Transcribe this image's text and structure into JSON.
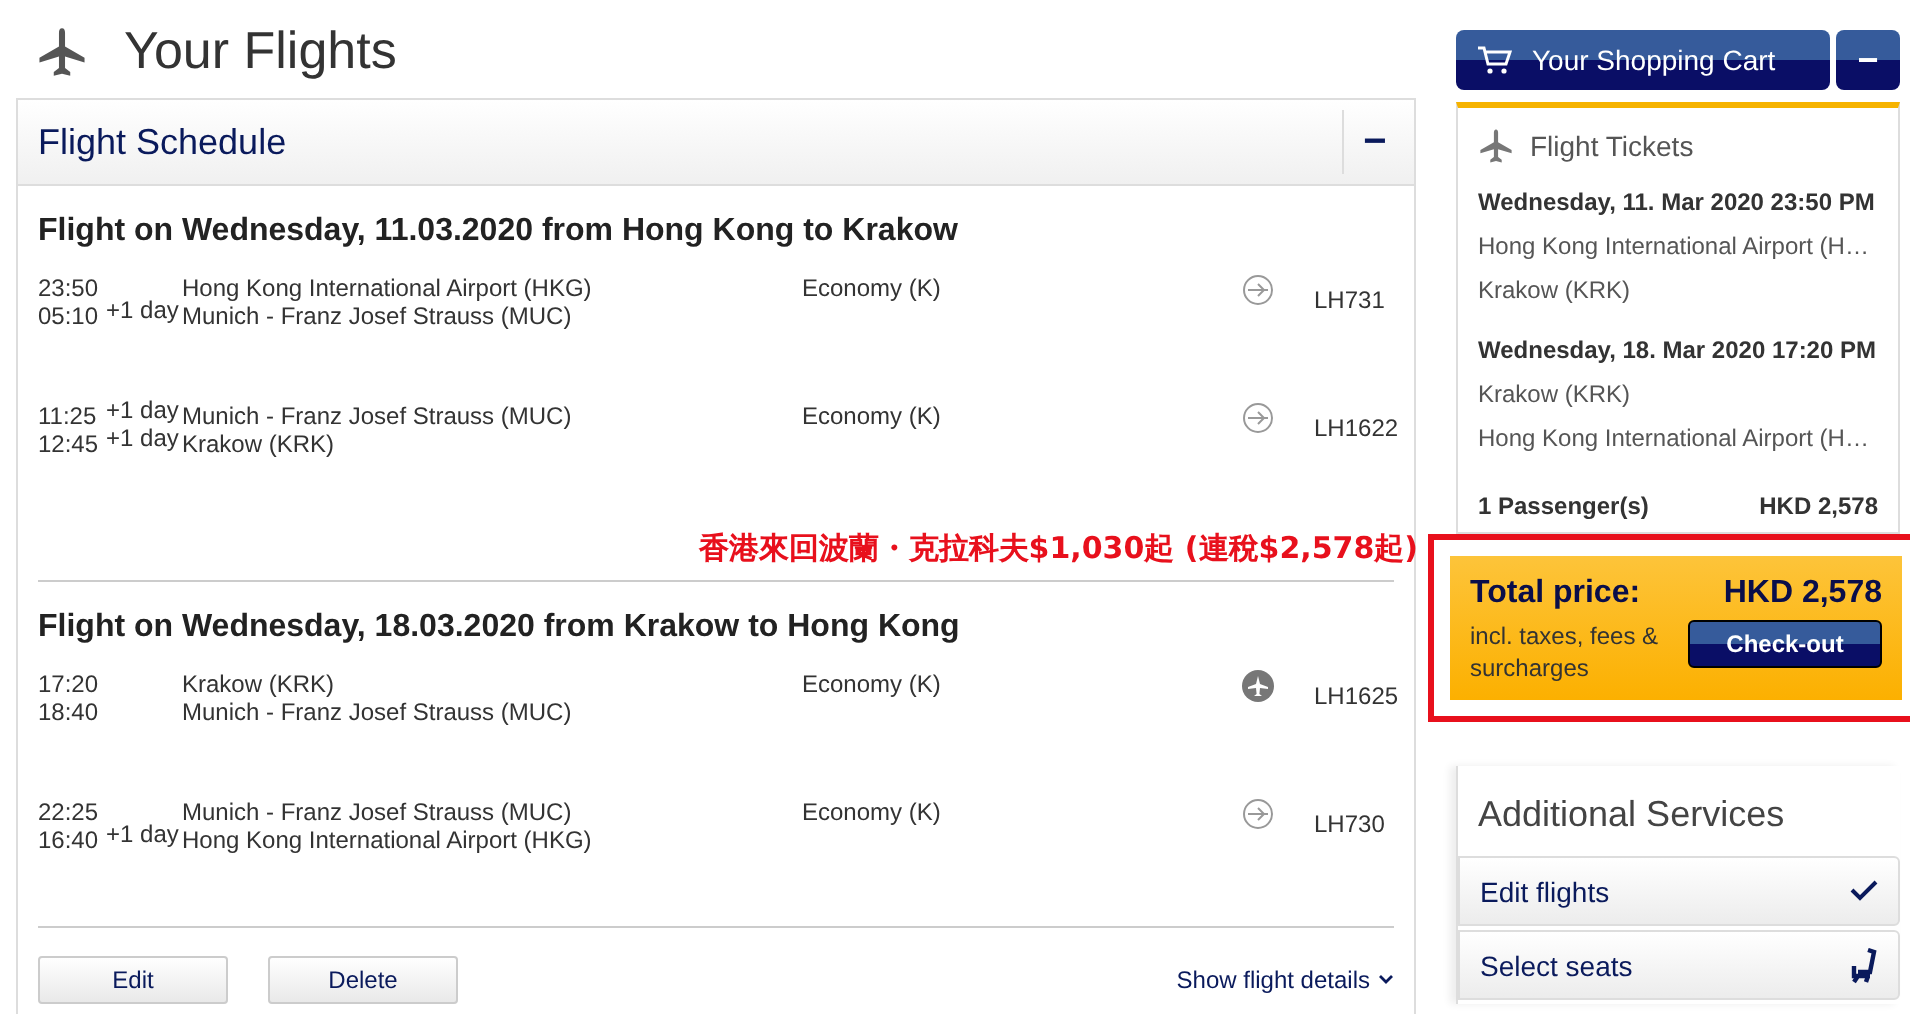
{
  "page_title": "Your Flights",
  "schedule": {
    "title": "Flight Schedule",
    "collapse": "−",
    "flights": [
      {
        "heading": "Flight on Wednesday, 11.03.2020 from Hong Kong to Krakow",
        "segments": [
          {
            "dep_time": "23:50",
            "from": "Hong Kong International Airport (HKG)",
            "arr_time": "05:10",
            "arr_plus": "+1 day",
            "to": "Munich - Franz Josef Strauss (MUC)",
            "cabin": "Economy (K)",
            "kind": "outline",
            "flight": "LH731"
          },
          {
            "dep_time": "11:25",
            "dep_plus": "+1 day",
            "from": "Munich - Franz Josef Strauss (MUC)",
            "arr_time": "12:45",
            "arr_plus": "+1 day",
            "to": "Krakow (KRK)",
            "cabin": "Economy (K)",
            "kind": "outline",
            "flight": "LH1622"
          }
        ],
        "annotation": "香港來回波蘭・克拉科夫$1,030起 (連稅$2,578起)"
      },
      {
        "heading": "Flight on Wednesday, 18.03.2020 from Krakow to Hong Kong",
        "segments": [
          {
            "dep_time": "17:20",
            "from": "Krakow (KRK)",
            "arr_time": "18:40",
            "to": "Munich - Franz Josef Strauss (MUC)",
            "cabin": "Economy (K)",
            "kind": "filled",
            "flight": "LH1625"
          },
          {
            "dep_time": "22:25",
            "from": "Munich - Franz Josef Strauss (MUC)",
            "arr_time": "16:40",
            "arr_plus": "+1 day",
            "to": "Hong Kong International Airport (HKG)",
            "cabin": "Economy (K)",
            "kind": "outline",
            "flight": "LH730"
          }
        ]
      }
    ],
    "buttons": [
      "Edit",
      "Delete"
    ],
    "details_link": "Show flight details"
  },
  "cart": {
    "title": "Your Shopping Cart",
    "collapse": "−",
    "section": "Flight Tickets",
    "legs": [
      {
        "date": "Wednesday, 11. Mar 2020 23:50 PM",
        "from": "Hong Kong International Airport (H…",
        "to": "Krakow (KRK)"
      },
      {
        "date": "Wednesday, 18. Mar 2020 17:20 PM",
        "from": "Krakow (KRK)",
        "to": "Hong Kong International Airport (H…"
      }
    ],
    "passengers": "1 Passenger(s)",
    "subtotal": "HKD 2,578"
  },
  "total": {
    "label": "Total price:",
    "amount": "HKD 2,578",
    "note": "incl. taxes, fees & surcharges",
    "checkout": "Check-out",
    "highlighted": true
  },
  "services": {
    "title": "Additional Services",
    "items": [
      {
        "label": "Edit flights",
        "kind": "check"
      },
      {
        "label": "Select seats",
        "kind": "seat"
      }
    ]
  }
}
